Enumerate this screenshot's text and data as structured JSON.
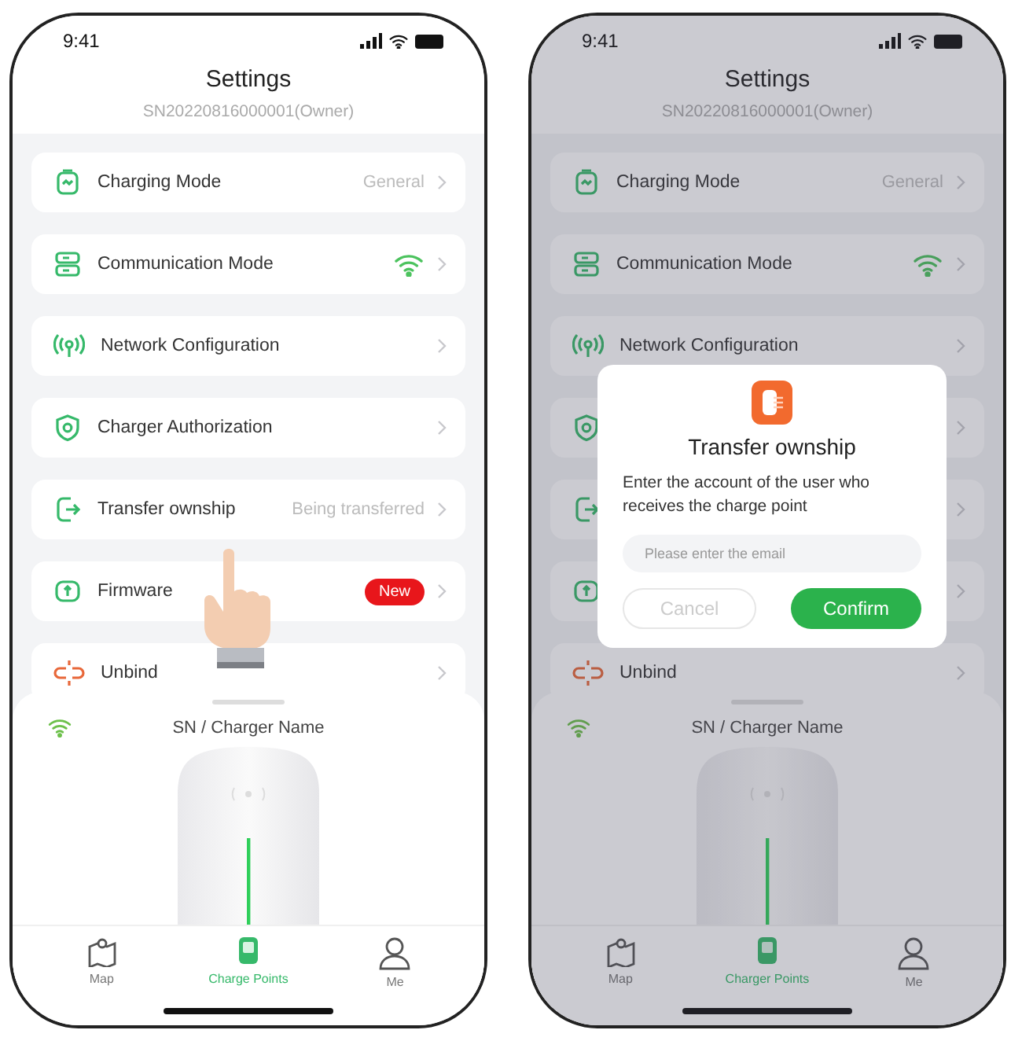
{
  "phones": [
    {
      "status_bar": {
        "time": "9:41"
      },
      "header": {
        "title": "Settings",
        "subtitle": "SN20220816000001(Owner)"
      },
      "settings": [
        {
          "kind": "charging",
          "label": "Charging Mode",
          "value": "General"
        },
        {
          "kind": "communication",
          "label": "Communication Mode"
        },
        {
          "kind": "network",
          "label": "Network Configuration"
        },
        {
          "kind": "authorization",
          "label": "Charger Authorization"
        },
        {
          "kind": "transfer",
          "label": "Transfer ownship",
          "value": "Being transferred"
        },
        {
          "kind": "firmware",
          "label": "Firmware",
          "badge": "New"
        },
        {
          "kind": "unbind",
          "label": "Unbind"
        }
      ],
      "device_sheet": {
        "name": "SN / Charger Name"
      },
      "tab_bar": [
        {
          "kind": "map",
          "label": "Map",
          "selected": false
        },
        {
          "kind": "charger",
          "label": "Charge Points",
          "selected": true
        },
        {
          "kind": "person",
          "label": "Me",
          "selected": false
        }
      ],
      "touch_hint": true
    },
    {
      "status_bar": {
        "time": "9:41"
      },
      "header": {
        "title": "Settings",
        "subtitle": "SN20220816000001(Owner)"
      },
      "settings": [
        {
          "kind": "charging",
          "label": "Charging Mode",
          "value": "General"
        },
        {
          "kind": "communication",
          "label": "Communication Mode"
        },
        {
          "kind": "network",
          "label": "Network Configuration"
        },
        {
          "kind": "authorization"
        },
        {
          "kind": "transfer"
        },
        {
          "kind": "firmware"
        },
        {
          "kind": "unbind",
          "label": "Unbind"
        }
      ],
      "device_sheet": {
        "name": "SN / Charger Name"
      },
      "tab_bar": [
        {
          "kind": "map",
          "label": "Map",
          "selected": false
        },
        {
          "kind": "charger",
          "label": "Charger Points",
          "selected": true
        },
        {
          "kind": "person",
          "label": "Me",
          "selected": false
        }
      ],
      "dialog": {
        "title": "Transfer ownship",
        "message": "Enter the account of the user who receives the charge point",
        "placeholder": "Please enter the email",
        "buttons": [
          {
            "kind": "cancel",
            "label": "Cancel"
          },
          {
            "kind": "confirm",
            "label": "Confirm"
          }
        ]
      }
    }
  ]
}
